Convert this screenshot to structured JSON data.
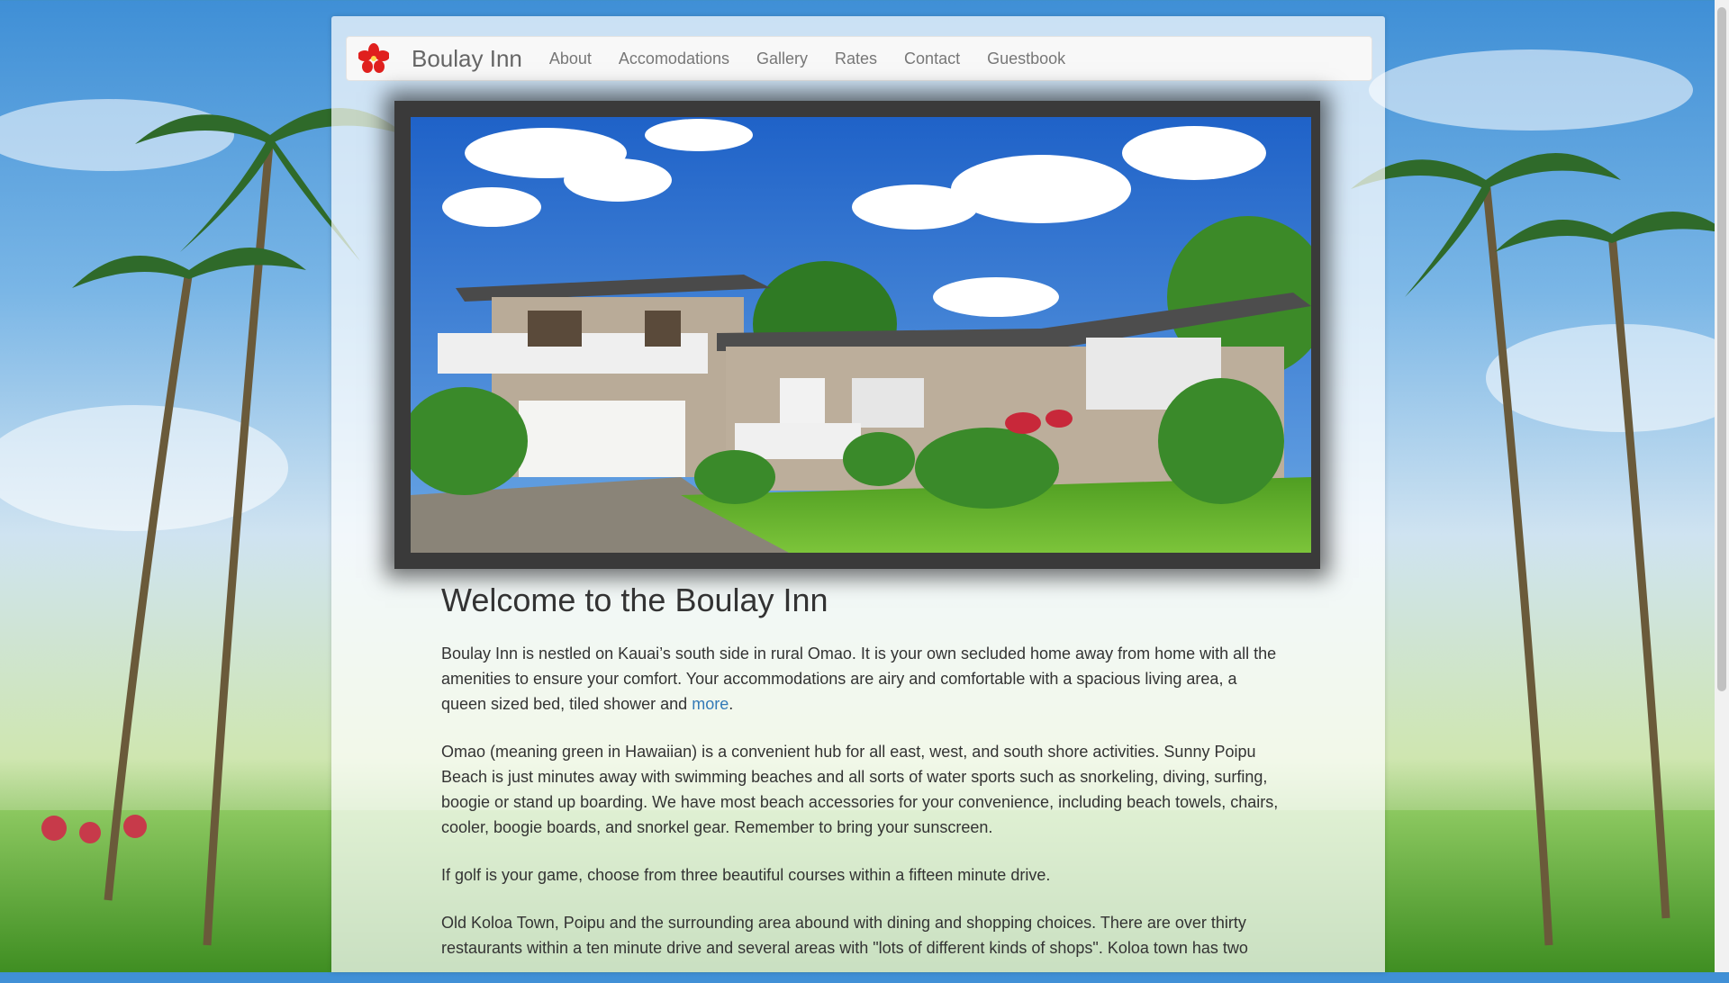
{
  "navbar": {
    "brand": "Boulay Inn",
    "links": [
      "About",
      "Accomodations",
      "Gallery",
      "Rates",
      "Contact",
      "Guestbook"
    ]
  },
  "main": {
    "heading": "Welcome to the Boulay Inn",
    "p1_text": "Boulay Inn is nestled on Kauai’s south side in rural Omao. It is your own secluded home away from home with all the amenities to ensure your comfort. Your accommodations are airy and comfortable with a spacious living area, a queen sized bed, tiled shower and ",
    "p1_link": "more",
    "p1_end": ".",
    "p2": "Omao (meaning green in Hawaiian) is a convenient hub for all east, west, and south shore activities. Sunny Poipu Beach is just minutes away with swimming beaches and all sorts of water sports such as snorkeling, diving, surfing, boogie or stand up boarding. We have most beach accessories for your convenience, including beach towels, chairs, cooler, boogie boards, and snorkel gear. Remember to bring your sunscreen.",
    "p3": "If golf is your game, choose from three beautiful courses within a fifteen minute drive.",
    "p4": "Old Koloa Town, Poipu and the surrounding area abound with dining and shopping choices. There are over thirty restaurants within a ten minute drive and several areas with \"lots of different kinds of shops\". Koloa town has two"
  },
  "colors": {
    "link": "#337ab7",
    "brand_icon": "#e0201e"
  },
  "icons": {
    "brand": "hibiscus-icon"
  }
}
